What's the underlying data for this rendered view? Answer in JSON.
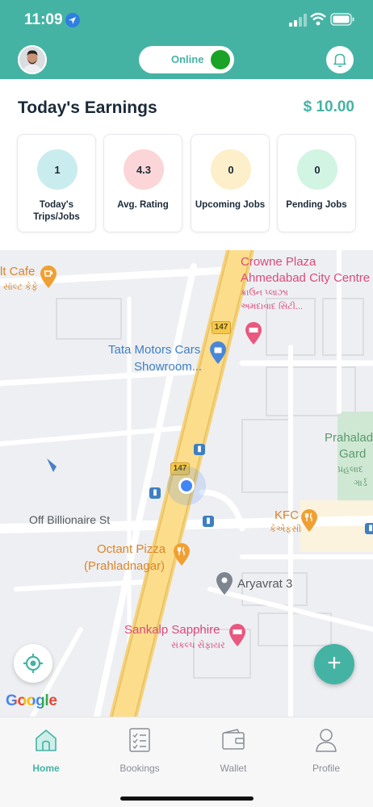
{
  "status_bar": {
    "time": "11:09"
  },
  "header": {
    "online_label": "Online",
    "online_color": "#1aa327",
    "accent": "#45b3a4"
  },
  "earnings": {
    "title": "Today's Earnings",
    "amount": "$ 10.00"
  },
  "stats": [
    {
      "value": "1",
      "label": "Today's Trips/Jobs",
      "color": "#c9ecef"
    },
    {
      "value": "4.3",
      "label": "Avg. Rating",
      "color": "#fbd5d7"
    },
    {
      "value": "0",
      "label": "Upcoming Jobs",
      "color": "#fcefc9"
    },
    {
      "value": "0",
      "label": "Pending Jobs",
      "color": "#d2f4e3"
    }
  ],
  "map": {
    "labels": {
      "cafe": "lt Cafe",
      "cafe_sub": "સૉલ્ટ કેફે",
      "crowne1": "Crowne Plaza",
      "crowne2": "Ahmedabad City Centre",
      "crowne_sub1": "ક્રાઉન પ્લાઝા",
      "crowne_sub2": "અમદાવાદ સિટી...",
      "tata1": "Tata Motors Cars",
      "tata2": "Showroom...",
      "prahlad1": "Prahalad",
      "prahlad2": "Gard",
      "prahlad_sub1": "પ્રહલાદ",
      "prahlad_sub2": "ગાર્ડ",
      "road": "Off Billionaire St",
      "kfc": "KFC",
      "kfc_sub": "કેએફસી",
      "octant1": "Octant Pizza",
      "octant2": "(Prahladnagar)",
      "aryavrat": "Aryavrat 3",
      "sankalp": "Sankalp Sapphire",
      "sankalp_sub": "સંકલ્પ સેફાયર",
      "route_badge": "147"
    },
    "attribution": "Google",
    "fab_symbol": "+"
  },
  "tabs": [
    {
      "label": "Home",
      "icon": "home-icon",
      "active": true
    },
    {
      "label": "Bookings",
      "icon": "checklist-icon",
      "active": false
    },
    {
      "label": "Wallet",
      "icon": "wallet-icon",
      "active": false
    },
    {
      "label": "Profile",
      "icon": "person-icon",
      "active": false
    }
  ]
}
